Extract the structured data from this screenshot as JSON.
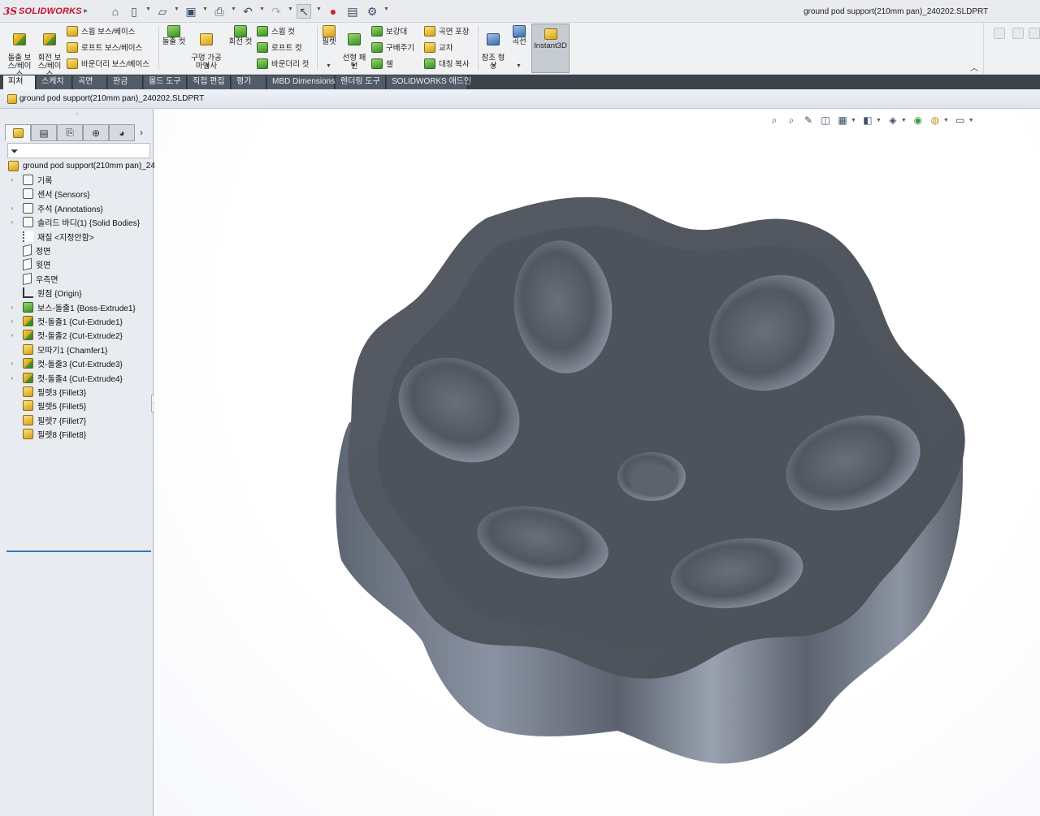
{
  "app": {
    "logo_prefix": "3S",
    "logo_text": "SOLIDWORKS",
    "document_title": "ground pod support(210mm pan)_240202.SLDPRT"
  },
  "quick_access": {
    "items": [
      "home-icon",
      "new-document-icon",
      "open-folder-icon",
      "save-icon",
      "print-icon",
      "undo-icon",
      "redo-icon",
      "select-arrow-icon",
      "traffic-light-icon",
      "file-properties-icon",
      "options-gear-icon"
    ]
  },
  "ribbon": {
    "extrude_boss": "돌출 보\n스/베이\n스",
    "revolve_boss": "회전 보\n스/베이\n스",
    "sweep_boss": "스윕 보스/베이스",
    "loft_boss": "로프트 보스/베이스",
    "boundary_boss": "바운더리 보스/베이스",
    "extrude_cut": "돌출 컷",
    "hole_wizard": "구멍 가공\n마법사",
    "revolve_cut": "회전 컷",
    "sweep_cut": "스윕 컷",
    "loft_cut": "로프트 컷",
    "boundary_cut": "바운더리 컷",
    "fillet": "필렛",
    "linear_pattern": "선형 패\n턴",
    "rib": "보강대",
    "draft": "구배주기",
    "shell": "쉘",
    "wrap": "곡면 포장",
    "intersect": "교차",
    "mirror": "대칭 복사",
    "reference_geometry": "참조 형\n상",
    "curves": "곡선",
    "instant3d": "Instant3D"
  },
  "tabs": [
    {
      "label": "피처",
      "active": true
    },
    {
      "label": "스케치",
      "active": false
    },
    {
      "label": "곡면",
      "active": false
    },
    {
      "label": "판금",
      "active": false
    },
    {
      "label": "몰드 도구",
      "active": false
    },
    {
      "label": "직접 편집",
      "active": false
    },
    {
      "label": "평가",
      "active": false
    },
    {
      "label": "MBD Dimensions",
      "active": false
    },
    {
      "label": "렌더링 도구",
      "active": false
    },
    {
      "label": "SOLIDWORKS 애드인",
      "active": false
    }
  ],
  "feature_tree": {
    "root": "ground pod support(210mm pan)_24",
    "nodes": [
      {
        "label": "기록",
        "icon": "history-folder-icon",
        "expandable": true
      },
      {
        "label": "센서 {Sensors}",
        "icon": "sensor-folder-icon",
        "expandable": false
      },
      {
        "label": "주석 {Annotations}",
        "icon": "annotations-folder-icon",
        "expandable": true
      },
      {
        "label": "솔리드 바디(1) {Solid Bodies}",
        "icon": "solid-bodies-folder-icon",
        "expandable": true
      },
      {
        "label": "재질 <지정안함>",
        "icon": "material-icon",
        "expandable": false
      },
      {
        "label": "정면",
        "icon": "plane-icon",
        "expandable": false
      },
      {
        "label": "윗면",
        "icon": "plane-icon",
        "expandable": false
      },
      {
        "label": "우측면",
        "icon": "plane-icon",
        "expandable": false
      },
      {
        "label": "원점 {Origin}",
        "icon": "origin-icon",
        "expandable": false
      },
      {
        "label": "보스-돌출1 {Boss-Extrude1}",
        "icon": "boss-extrude-icon",
        "expandable": true
      },
      {
        "label": "컷-돌출1 {Cut-Extrude1}",
        "icon": "cut-extrude-icon",
        "expandable": true
      },
      {
        "label": "컷-돌출2 {Cut-Extrude2}",
        "icon": "cut-extrude-icon",
        "expandable": true
      },
      {
        "label": "모따기1 {Chamfer1}",
        "icon": "chamfer-icon",
        "expandable": false
      },
      {
        "label": "컷-돌출3 {Cut-Extrude3}",
        "icon": "cut-extrude-icon",
        "expandable": true
      },
      {
        "label": "컷-돌출4 {Cut-Extrude4}",
        "icon": "cut-extrude-icon",
        "expandable": true
      },
      {
        "label": "필렛3 {Fillet3}",
        "icon": "fillet-icon",
        "expandable": false
      },
      {
        "label": "필렛5 {Fillet5}",
        "icon": "fillet-icon",
        "expandable": false
      },
      {
        "label": "필렛7 {Fillet7}",
        "icon": "fillet-icon",
        "expandable": false
      },
      {
        "label": "필렛8 {Fillet8}",
        "icon": "fillet-icon",
        "expandable": false
      }
    ]
  },
  "panel_tabs": [
    "feature-manager-icon",
    "property-manager-icon",
    "configuration-manager-icon",
    "dimxpert-icon",
    "display-manager-icon"
  ],
  "heads_up_toolbar": [
    "zoom-to-fit-icon",
    "zoom-to-area-icon",
    "previous-view-icon",
    "section-view-icon",
    "view-orientation-icon",
    "display-style-icon",
    "hide-show-items-icon",
    "edit-appearance-icon",
    "apply-scene-icon",
    "view-settings-icon"
  ],
  "colors": {
    "model_top": "#4f545d",
    "model_side": "#6c7380",
    "tab_bar": "#3c434d",
    "selection_line": "#3a78b5"
  }
}
